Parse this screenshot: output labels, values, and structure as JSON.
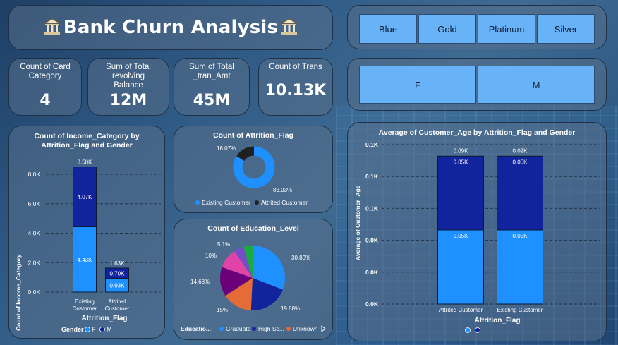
{
  "title": "Bank Churn Analysis",
  "slicers": {
    "card_category": [
      "Blue",
      "Gold",
      "Platinum",
      "Silver"
    ],
    "gender": [
      "F",
      "M"
    ]
  },
  "kpis": [
    {
      "label": "Count of Card Category",
      "value": "4"
    },
    {
      "label": "Sum of Total revolving Balance",
      "value": "12M"
    },
    {
      "label": "Sum of Total _tran_Amt",
      "value": "45M"
    },
    {
      "label": "Count of Trans",
      "value": "10.13K"
    }
  ],
  "colors": {
    "female": "#1e90ff",
    "male": "#12239e",
    "existing": "#1e90ff",
    "attrited": "#202020"
  },
  "chart_income": {
    "title": "Count of Income_Category by Attrition_Flag and Gender",
    "xlabel": "Attrition_Flag",
    "ylabel": "Count of Income_Category",
    "legend_title": "Gender",
    "legend": [
      "F",
      "M"
    ],
    "yticks": [
      "0.0K",
      "2.0K",
      "4.0K",
      "6.0K",
      "8.0K"
    ],
    "categories": [
      "Existing Customer",
      "Attrited Customer"
    ],
    "cat_lines": [
      [
        "Existing",
        "Customer"
      ],
      [
        "Attrited",
        "Customer"
      ]
    ],
    "totals": [
      "8.50K",
      "1.63K"
    ],
    "f_labels": [
      "4.43K",
      "0.93K"
    ],
    "m_labels": [
      "4.07K",
      "0.70K"
    ]
  },
  "chart_attrition": {
    "title": "Count of Attrition_Flag",
    "pct_existing": "83.93%",
    "pct_attrited": "16.07%",
    "legend": [
      "Existing Customer",
      "Attrited Customer"
    ]
  },
  "chart_education": {
    "title": "Count of Education_Level",
    "legend_title": "Educatio...",
    "legend": [
      "Graduate",
      "High Sc...",
      "Unknown"
    ],
    "labels": [
      "30.89%",
      "19.88%",
      "15%",
      "14.68%",
      "10%",
      "5.1%"
    ]
  },
  "chart_age": {
    "title": "Average of Customer_Age by Attrition_Flag and Gender",
    "xlabel": "Attrition_Flag",
    "ylabel": "Average of Customer_Age",
    "yticks": [
      "0.0K",
      "0.0K",
      "0.0K",
      "0.1K",
      "0.1K",
      "0.1K"
    ],
    "categories": [
      "Attrited Customer",
      "Existing Customer"
    ],
    "totals": [
      "0.09K",
      "0.09K"
    ],
    "f_labels": [
      "0.05K",
      "0.05K"
    ],
    "m_labels": [
      "0.05K",
      "0.05K"
    ]
  },
  "chart_data": [
    {
      "type": "bar",
      "title": "Count of Income_Category by Attrition_Flag and Gender",
      "xlabel": "Attrition_Flag",
      "ylabel": "Count of Income_Category",
      "categories": [
        "Existing Customer",
        "Attrited Customer"
      ],
      "series": [
        {
          "name": "F",
          "values": [
            4430,
            930
          ]
        },
        {
          "name": "M",
          "values": [
            4070,
            700
          ]
        }
      ],
      "ylim": [
        0,
        8500
      ],
      "legend": "bottom",
      "grid": true
    },
    {
      "type": "pie",
      "title": "Count of Attrition_Flag",
      "categories": [
        "Existing Customer",
        "Attrited Customer"
      ],
      "values": [
        83.93,
        16.07
      ],
      "legend": "bottom"
    },
    {
      "type": "pie",
      "title": "Count of Education_Level",
      "values": [
        30.89,
        19.88,
        15,
        14.68,
        10,
        5.1,
        4.45
      ],
      "legend": "bottom"
    },
    {
      "type": "bar",
      "title": "Average of Customer_Age by Attrition_Flag and Gender",
      "xlabel": "Attrition_Flag",
      "ylabel": "Average of Customer_Age",
      "categories": [
        "Attrited Customer",
        "Existing Customer"
      ],
      "series": [
        {
          "name": "F",
          "values": [
            46.5,
            46.5
          ]
        },
        {
          "name": "M",
          "values": [
            46.3,
            46.3
          ]
        }
      ],
      "ylim": [
        0,
        100
      ],
      "legend": "bottom",
      "grid": true
    }
  ]
}
